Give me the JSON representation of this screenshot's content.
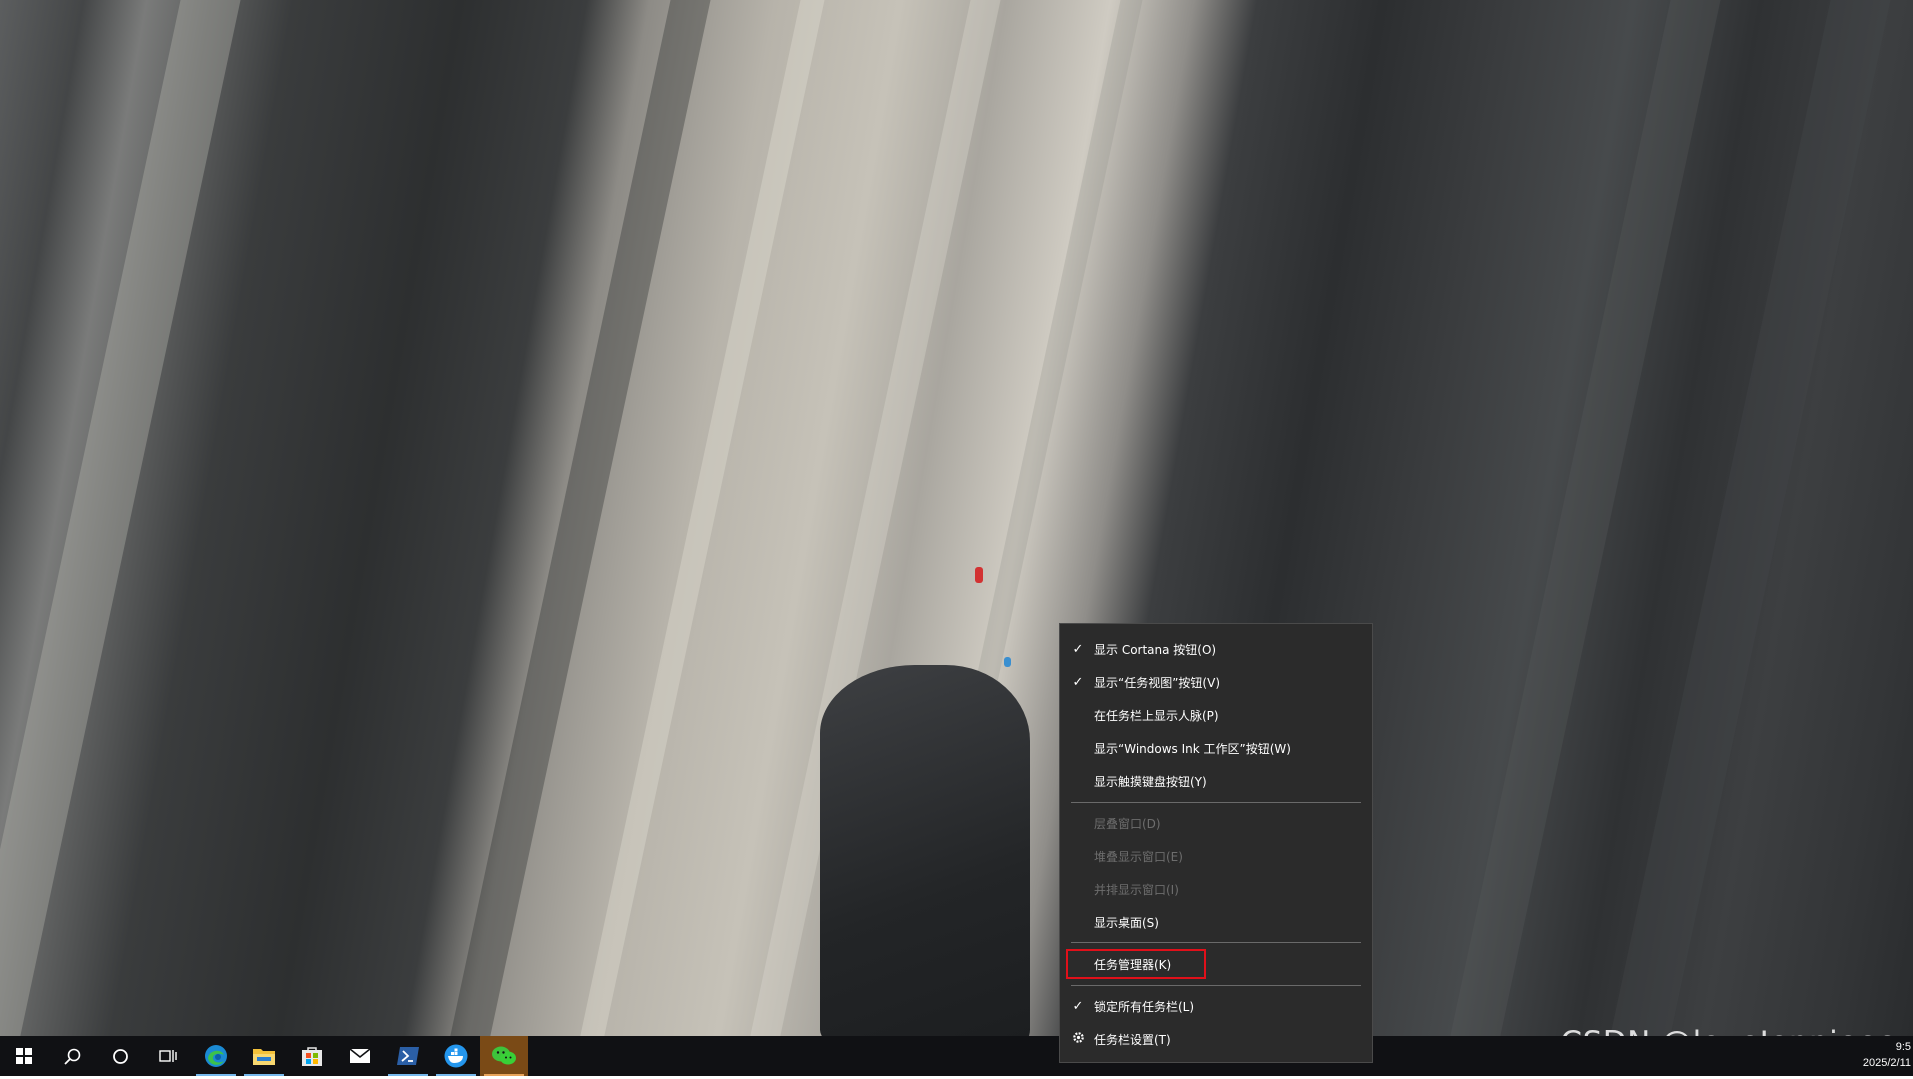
{
  "desktop": {
    "wallpaper": "granite-cliff-with-climbers"
  },
  "context_menu": {
    "items": [
      {
        "label": "显示 Cortana 按钮(O)",
        "checked": true
      },
      {
        "label": "显示“任务视图”按钮(V)",
        "checked": true
      },
      {
        "label": "在任务栏上显示人脉(P)",
        "checked": false
      },
      {
        "label": "显示“Windows Ink 工作区”按钮(W)",
        "checked": false
      },
      {
        "label": "显示触摸键盘按钮(Y)",
        "checked": false
      },
      {
        "label": "层叠窗口(D)",
        "disabled": true
      },
      {
        "label": "堆叠显示窗口(E)",
        "disabled": true
      },
      {
        "label": "并排显示窗口(I)",
        "disabled": true
      },
      {
        "label": "显示桌面(S)",
        "disabled": false
      },
      {
        "label": "任务管理器(K)",
        "highlighted": true
      },
      {
        "label": "锁定所有任务栏(L)",
        "checked": true
      },
      {
        "label": "任务栏设置(T)",
        "icon": "gear-icon"
      }
    ],
    "check_glyph": "✓",
    "highlight_color": "#e0101a"
  },
  "taskbar": {
    "icons": [
      "windows-start-icon",
      "search-icon",
      "cortana-icon",
      "task-view-icon",
      "edge-icon",
      "file-explorer-icon",
      "microsoft-store-icon",
      "mail-icon",
      "powershell-icon",
      "docker-icon",
      "wechat-icon"
    ],
    "accent": "#76b9ed"
  },
  "tray": {
    "time": "9:5",
    "date": "2025/2/11"
  },
  "watermark": {
    "text": "CSDN @loveJennieee"
  }
}
